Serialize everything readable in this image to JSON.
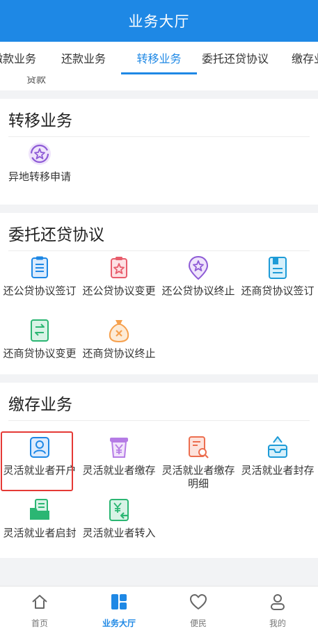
{
  "header": {
    "title": "业务大厅"
  },
  "tabs": [
    "缴款业务",
    "还款业务",
    "转移业务",
    "委托还贷协议",
    "缴存业"
  ],
  "partial_above": {
    "label": "贷款"
  },
  "sections": [
    {
      "title": "转移业务",
      "items": [
        {
          "label": "异地转移申请",
          "icon": "star-circle-icon"
        }
      ]
    },
    {
      "title": "委托还贷协议",
      "items": [
        {
          "label": "还公贷协议签订",
          "icon": "document-list-icon"
        },
        {
          "label": "还公贷协议变更",
          "icon": "clipboard-star-icon"
        },
        {
          "label": "还公贷协议终止",
          "icon": "location-star-icon"
        },
        {
          "label": "还商贷协议签订",
          "icon": "notebook-icon"
        },
        {
          "label": "还商贷协议变更",
          "icon": "exchange-document-icon"
        },
        {
          "label": "还商贷协议终止",
          "icon": "money-bag-x-icon"
        }
      ]
    },
    {
      "title": "缴存业务",
      "items": [
        {
          "label": "灵活就业者开户",
          "icon": "user-card-icon"
        },
        {
          "label": "灵活就业者缴存",
          "icon": "yuan-deposit-icon"
        },
        {
          "label": "灵活就业者缴存明细",
          "icon": "document-search-icon"
        },
        {
          "label": "灵活就业者封存",
          "icon": "sealed-box-icon"
        },
        {
          "label": "灵活就业者启封",
          "icon": "open-folder-icon"
        },
        {
          "label": "灵活就业者转入",
          "icon": "yuan-transfer-icon"
        }
      ]
    }
  ],
  "bottom_nav": [
    {
      "label": "首页",
      "icon": "home-icon"
    },
    {
      "label": "业务大厅",
      "icon": "grid-icon"
    },
    {
      "label": "便民",
      "icon": "heart-icon"
    },
    {
      "label": "我的",
      "icon": "user-icon"
    }
  ],
  "colors": {
    "primary": "#1e88e5",
    "highlight": "#e53935"
  }
}
